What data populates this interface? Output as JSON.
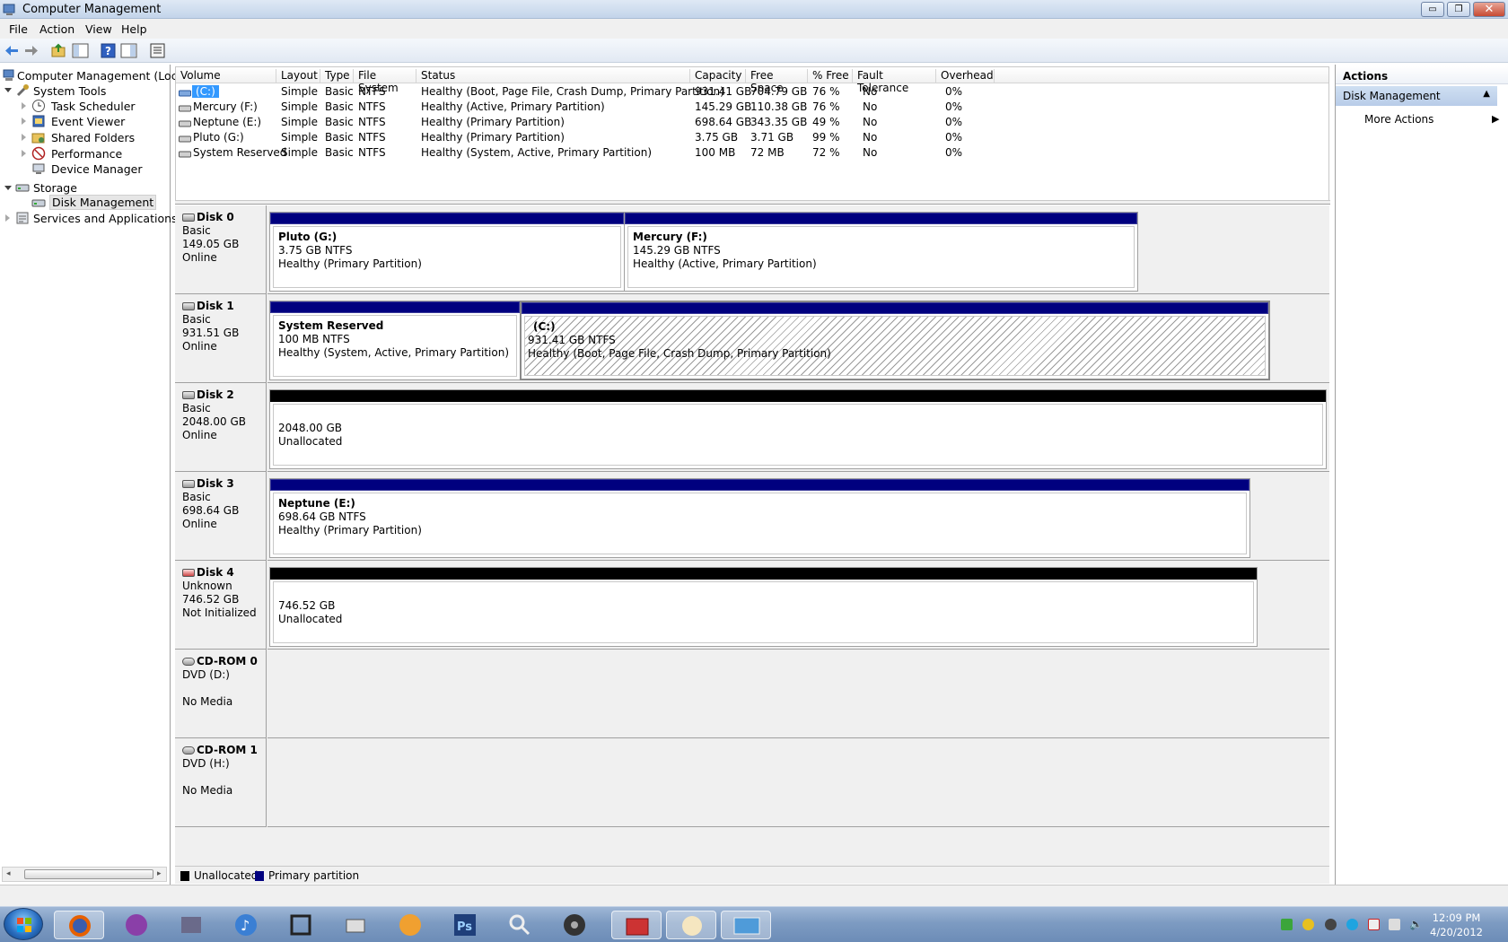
{
  "window": {
    "title": "Computer Management",
    "min": "▭",
    "max": "❐",
    "close": "✕"
  },
  "menu": {
    "file": "File",
    "action": "Action",
    "view": "View",
    "help": "Help"
  },
  "tree": {
    "root": "Computer Management (Local)",
    "system_tools": "System Tools",
    "task_scheduler": "Task Scheduler",
    "event_viewer": "Event Viewer",
    "shared_folders": "Shared Folders",
    "performance": "Performance",
    "device_manager": "Device Manager",
    "storage": "Storage",
    "disk_management": "Disk Management",
    "services": "Services and Applications"
  },
  "volume_columns": {
    "volume": "Volume",
    "layout": "Layout",
    "type": "Type",
    "fs": "File System",
    "status": "Status",
    "capacity": "Capacity",
    "free": "Free Space",
    "pct": "% Free",
    "fault": "Fault Tolerance",
    "overhead": "Overhead"
  },
  "volumes": [
    {
      "volume": "(C:)",
      "layout": "Simple",
      "type": "Basic",
      "fs": "NTFS",
      "status": "Healthy (Boot, Page File, Crash Dump, Primary Partition)",
      "capacity": "931.41 GB",
      "free": "704.79 GB",
      "pct": "76 %",
      "fault": "No",
      "overhead": "0%"
    },
    {
      "volume": "Mercury (F:)",
      "layout": "Simple",
      "type": "Basic",
      "fs": "NTFS",
      "status": "Healthy (Active, Primary Partition)",
      "capacity": "145.29 GB",
      "free": "110.38 GB",
      "pct": "76 %",
      "fault": "No",
      "overhead": "0%"
    },
    {
      "volume": "Neptune (E:)",
      "layout": "Simple",
      "type": "Basic",
      "fs": "NTFS",
      "status": "Healthy (Primary Partition)",
      "capacity": "698.64 GB",
      "free": "343.35 GB",
      "pct": "49 %",
      "fault": "No",
      "overhead": "0%"
    },
    {
      "volume": "Pluto (G:)",
      "layout": "Simple",
      "type": "Basic",
      "fs": "NTFS",
      "status": "Healthy (Primary Partition)",
      "capacity": "3.75 GB",
      "free": "3.71 GB",
      "pct": "99 %",
      "fault": "No",
      "overhead": "0%"
    },
    {
      "volume": "System Reserved",
      "layout": "Simple",
      "type": "Basic",
      "fs": "NTFS",
      "status": "Healthy (System, Active, Primary Partition)",
      "capacity": "100 MB",
      "free": "72 MB",
      "pct": "72 %",
      "fault": "No",
      "overhead": "0%"
    }
  ],
  "disks": [
    {
      "name": "Disk 0",
      "kind": "Basic",
      "size": "149.05 GB",
      "state": "Online",
      "p0": {
        "name": "Pluto  (G:)",
        "size": "3.75 GB NTFS",
        "status": "Healthy (Primary Partition)"
      },
      "p1": {
        "name": "Mercury  (F:)",
        "size": "145.29 GB NTFS",
        "status": "Healthy (Active, Primary Partition)"
      }
    },
    {
      "name": "Disk 1",
      "kind": "Basic",
      "size": "931.51 GB",
      "state": "Online",
      "p0": {
        "name": "System Reserved",
        "size": "100 MB NTFS",
        "status": "Healthy (System, Active, Primary Partition)"
      },
      "p1": {
        "name": "(C:)",
        "size": "931.41 GB NTFS",
        "status": "Healthy (Boot, Page File, Crash Dump, Primary Partition)"
      }
    },
    {
      "name": "Disk 2",
      "kind": "Basic",
      "size": "2048.00 GB",
      "state": "Online",
      "p0": {
        "size": "2048.00 GB",
        "status": "Unallocated"
      }
    },
    {
      "name": "Disk 3",
      "kind": "Basic",
      "size": "698.64 GB",
      "state": "Online",
      "p0": {
        "name": "Neptune  (E:)",
        "size": "698.64 GB NTFS",
        "status": "Healthy (Primary Partition)"
      }
    },
    {
      "name": "Disk 4",
      "kind": "Unknown",
      "size": "746.52 GB",
      "state": "Not Initialized",
      "p0": {
        "size": "746.52 GB",
        "status": "Unallocated"
      }
    },
    {
      "name": "CD-ROM 0",
      "kind": "DVD (D:)",
      "state": "No Media"
    },
    {
      "name": "CD-ROM 1",
      "kind": "DVD (H:)",
      "state": "No Media"
    }
  ],
  "legend": {
    "unallocated": "Unallocated",
    "primary": "Primary partition"
  },
  "actions": {
    "header": "Actions",
    "section": "Disk Management",
    "more": "More Actions"
  },
  "clock": {
    "time": "12:09 PM",
    "date": "4/20/2012"
  },
  "colors": {
    "primary": "#00007f",
    "unallocated": "#000000"
  }
}
